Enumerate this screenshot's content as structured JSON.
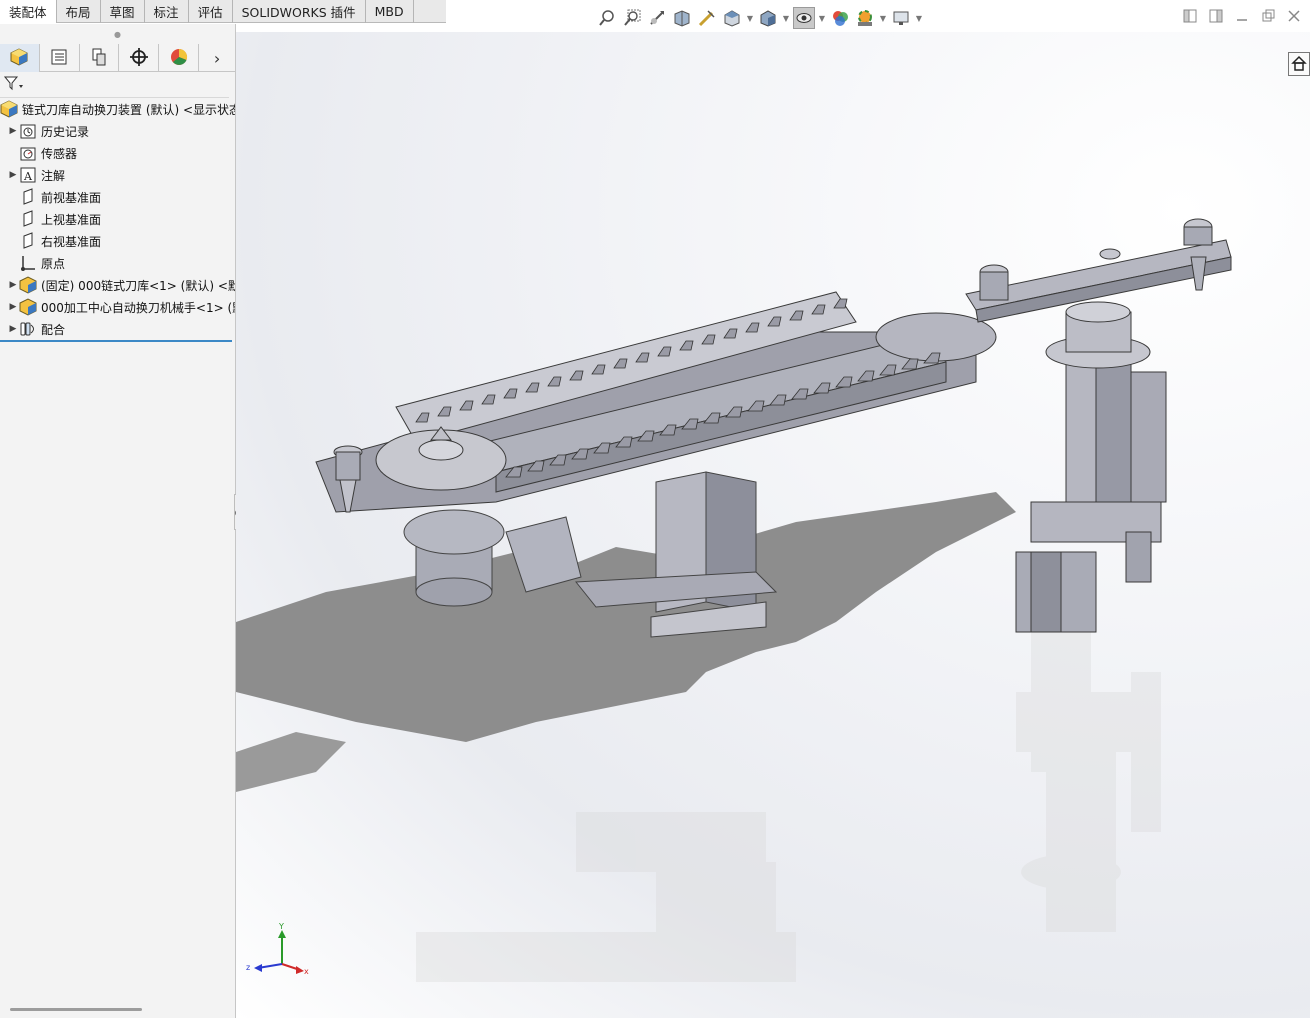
{
  "tabs": [
    {
      "label": "装配体"
    },
    {
      "label": "布局"
    },
    {
      "label": "草图"
    },
    {
      "label": "标注"
    },
    {
      "label": "评估"
    },
    {
      "label": "SOLIDWORKS 插件"
    },
    {
      "label": "MBD"
    }
  ],
  "view_toolbar": [
    "zoom-to-fit-icon",
    "zoom-to-area-icon",
    "previous-view-icon",
    "section-view-icon",
    "dynamic-annotation-icon",
    "view-orientation-icon",
    "display-style-icon",
    "hide-show-items-icon",
    "edit-appearance-icon",
    "apply-scene-icon",
    "view-settings-icon"
  ],
  "feature_tree": {
    "root_label": "链式刀库自动换刀装置 (默认) <显示状态",
    "items": [
      {
        "label": "历史记录",
        "icon": "history-icon",
        "expandable": true
      },
      {
        "label": "传感器",
        "icon": "sensor-icon",
        "expandable": false
      },
      {
        "label": "注解",
        "icon": "annotations-icon",
        "expandable": true
      },
      {
        "label": "前视基准面",
        "icon": "plane-icon",
        "expandable": false
      },
      {
        "label": "上视基准面",
        "icon": "plane-icon",
        "expandable": false
      },
      {
        "label": "右视基准面",
        "icon": "plane-icon",
        "expandable": false
      },
      {
        "label": "原点",
        "icon": "origin-icon",
        "expandable": false
      },
      {
        "label": "(固定) 000链式刀库<1> (默认) <默",
        "icon": "part-icon",
        "expandable": true
      },
      {
        "label": "000加工中心自动换刀机械手<1> (默",
        "icon": "part-icon",
        "expandable": true
      },
      {
        "label": "配合",
        "icon": "mates-icon",
        "expandable": true
      }
    ]
  },
  "triad": {
    "x": "x",
    "y": "Y",
    "z": "z"
  },
  "colors": {
    "accent": "#3b88c6",
    "model": "#b9bac4",
    "shadow": "#9a9a9a"
  }
}
